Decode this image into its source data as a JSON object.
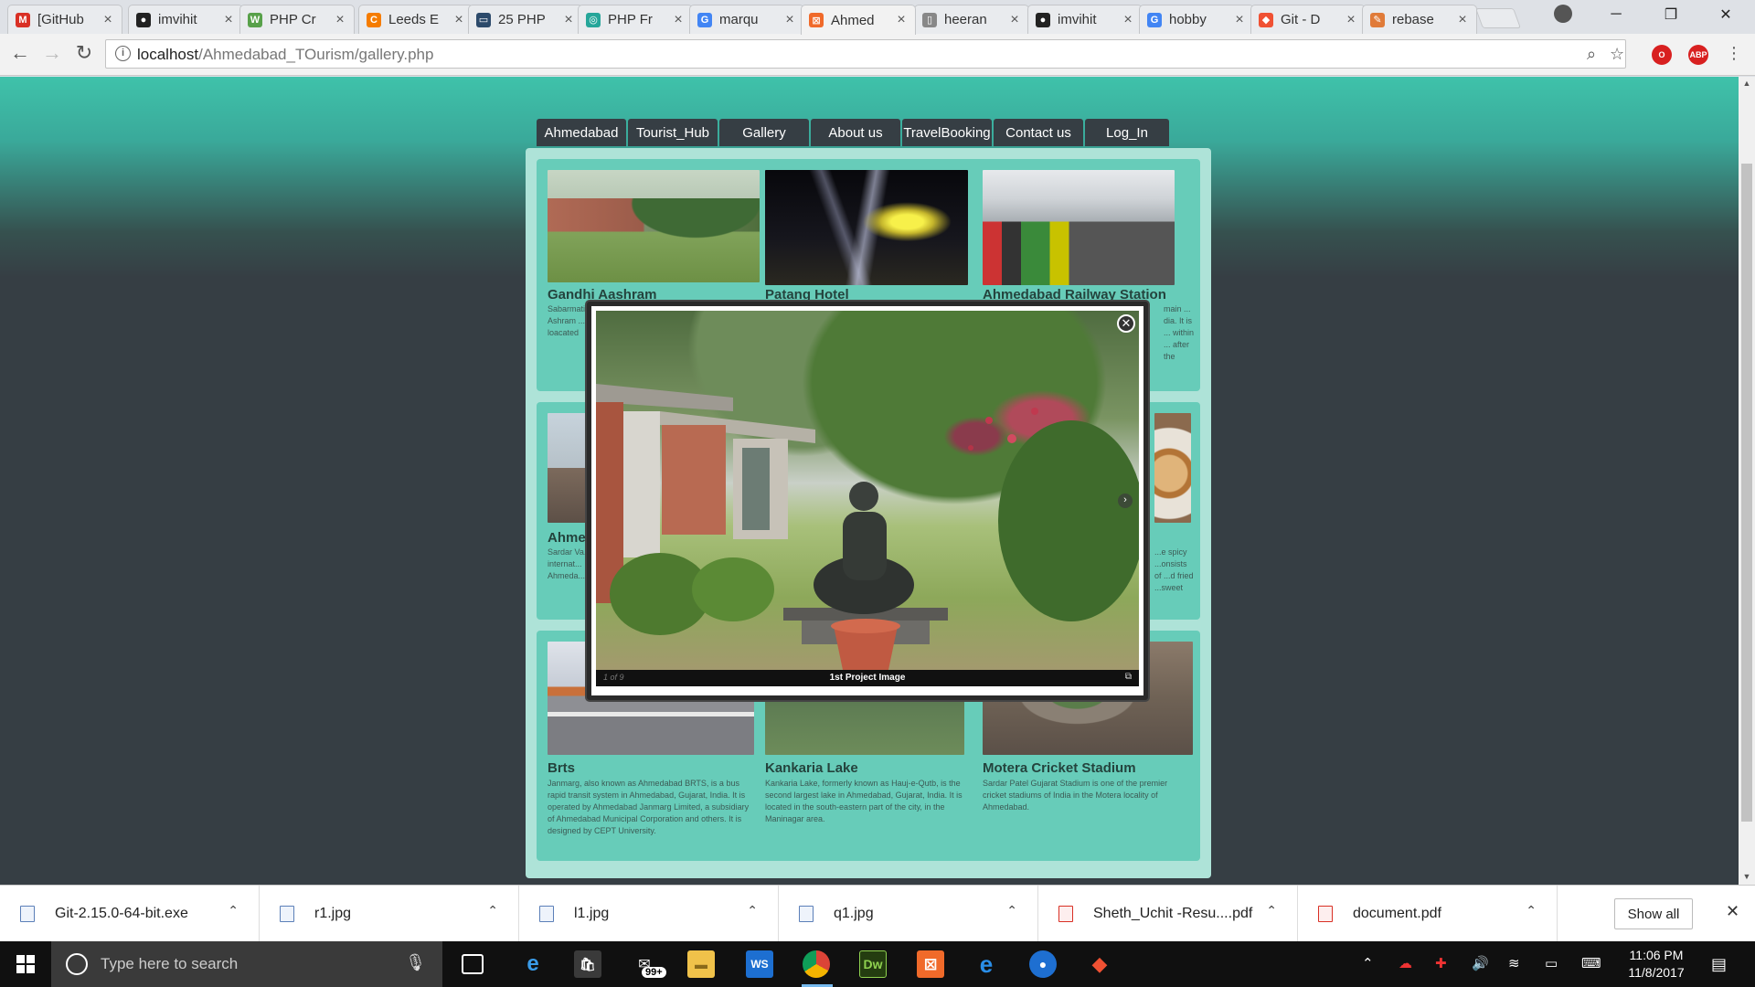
{
  "browser": {
    "tabs": [
      {
        "title": "[GitHub",
        "favicon": "gmail-icon",
        "color": "#d93025",
        "glyph": "M"
      },
      {
        "title": "imvihit",
        "favicon": "github-icon",
        "color": "#222222",
        "glyph": "●"
      },
      {
        "title": "PHP Cr",
        "favicon": "php-site-icon",
        "color": "#58a14a",
        "glyph": "W"
      },
      {
        "title": "Leeds E",
        "favicon": "leeds-icon",
        "color": "#f57c00",
        "glyph": "C"
      },
      {
        "title": "25 PHP",
        "favicon": "monitor-icon",
        "color": "#2c4a6b",
        "glyph": "▭"
      },
      {
        "title": "PHP Fr",
        "favicon": "php-framework-icon",
        "color": "#26a69a",
        "glyph": "◎"
      },
      {
        "title": "marqu",
        "favicon": "google-icon",
        "color": "#4285f4",
        "glyph": "G"
      },
      {
        "title": "Ahmed",
        "favicon": "xampp-icon",
        "color": "#f06a2a",
        "glyph": "⊠"
      },
      {
        "title": "heeran",
        "favicon": "document-icon",
        "color": "#888888",
        "glyph": "▯"
      },
      {
        "title": "imvihit",
        "favicon": "github-icon",
        "color": "#222222",
        "glyph": "●"
      },
      {
        "title": "hobby",
        "favicon": "google-icon",
        "color": "#4285f4",
        "glyph": "G"
      },
      {
        "title": "Git - D",
        "favicon": "git-icon",
        "color": "#f05133",
        "glyph": "◆"
      },
      {
        "title": "rebase",
        "favicon": "rebase-icon",
        "color": "#e07b39",
        "glyph": "✎"
      }
    ],
    "active_tab_index": 7,
    "url_host": "localhost",
    "url_path": "/Ahmedabad_TOurism/gallery.php"
  },
  "site": {
    "menu": [
      "Ahmedabad",
      "Tourist_Hub",
      "Gallery",
      "About us",
      "TravelBooking",
      "Contact us",
      "Log_In"
    ]
  },
  "gallery": {
    "row1": [
      {
        "title": "Gandhi Aashram",
        "desc": "Sabarmati Ashram ... is loacated"
      },
      {
        "title": "Patang Hotel",
        "desc": ""
      },
      {
        "title": "Ahmedabad Railway Station",
        "desc": "main ... dia. It is ... within ... after the"
      }
    ],
    "row2": [
      {
        "title": "Ahme",
        "desc": "Sardar Va... internat... Ahmeda..."
      },
      {
        "title": "",
        "desc": ""
      },
      {
        "title": "",
        "desc": "...e spicy ...onsists of ...d fried ...sweet"
      }
    ],
    "row3": [
      {
        "title": "Brts",
        "desc": "Janmarg, also known as Ahmedabad BRTS, is a bus rapid transit system in Ahmedabad, Gujarat, India. It is operated by Ahmedabad Janmarg Limited, a subsidiary of Ahmedabad Municipal Corporation and others. It is designed by CEPT University."
      },
      {
        "title": "Kankaria Lake",
        "desc": "Kankaria Lake, formerly known as Hauj-e-Qutb, is the second largest lake in Ahmedabad, Gujarat, India. It is located in the south-eastern part of the city, in the Maninagar area."
      },
      {
        "title": "Motera Cricket Stadium",
        "desc": "Sardar Patel Gujarat Stadium is one of the premier cricket stadiums of India in the Motera locality of Ahmedabad."
      }
    ]
  },
  "lightbox": {
    "counter": "1 of 9",
    "caption": "1st Project Image",
    "close_glyph": "✕",
    "next_glyph": "›",
    "external_glyph": "⧉"
  },
  "downloads": {
    "items": [
      "Git-2.15.0-64-bit.exe",
      "r1.jpg",
      "l1.jpg",
      "q1.jpg",
      "Sheth_Uchit -Resu....pdf",
      "document.pdf"
    ],
    "show_all": "Show all"
  },
  "taskbar": {
    "search_placeholder": "Type here to search",
    "mail_badge": "99+",
    "time": "11:06 PM",
    "date": "11/8/2017"
  }
}
